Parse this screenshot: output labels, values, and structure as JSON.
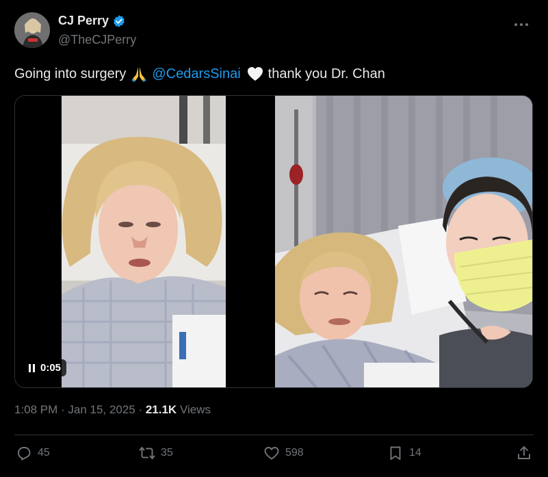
{
  "author": {
    "display_name": "CJ Perry",
    "handle": "@TheCJPerry",
    "verified": true
  },
  "tweet": {
    "text_part1": "Going into surgery",
    "mention": "@CedarsSinai",
    "text_part2": "thank you Dr. Chan",
    "emojis": [
      "folded-hands-emoji",
      "white-heart-emoji"
    ]
  },
  "media": {
    "video_time": "0:05"
  },
  "meta": {
    "time": "1:08 PM",
    "sep1": " · ",
    "date": "Jan 15, 2025",
    "sep2": " · ",
    "views_count": "21.1K",
    "views_label": " Views"
  },
  "actions": {
    "replies": "45",
    "reposts": "35",
    "likes": "598",
    "bookmarks": "14"
  },
  "colors": {
    "background": "#000000",
    "text": "#e7e9ea",
    "secondary": "#71767b",
    "accent": "#1d9bf0",
    "divider": "#2f3336"
  },
  "icons": [
    "verified-icon",
    "more-icon",
    "reply-icon",
    "repost-icon",
    "like-icon",
    "bookmark-icon",
    "share-icon",
    "pause-icon"
  ]
}
